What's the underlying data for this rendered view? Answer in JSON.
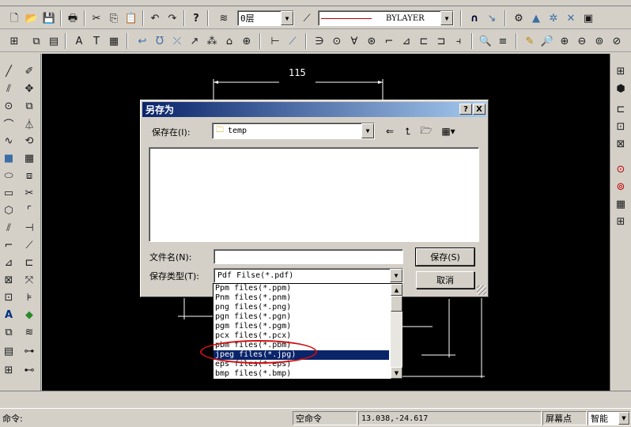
{
  "layer_combo": {
    "value": "0层"
  },
  "linetype_combo": {
    "value": "BYLAYER"
  },
  "drawing": {
    "dim_top": "115"
  },
  "dialog": {
    "title": "另存为",
    "help_btn": "?",
    "close_btn": "X",
    "save_in_label": "保存在(I):",
    "save_in_value": "temp",
    "filename_label": "文件名(N):",
    "filename_value": "",
    "filetype_label": "保存类型(T):",
    "filetype_value": "Pdf Filse(*.pdf)",
    "save_button": "保存(S)",
    "cancel_button": "取消"
  },
  "filetype_options": [
    "Ppm files(*.ppm)",
    "Pnm files(*.pnm)",
    "png files(*.png)",
    "pgn files(*.pgn)",
    "pgm files(*.pgm)",
    "pcx files(*.pcx)",
    "pbm files(*.pbm)",
    "jpeg files(*.jpg)",
    "eps files(*.eps)",
    "bmp files(*.bmp)"
  ],
  "filetype_selected_index": 7,
  "statusbar": {
    "command_prompt": "命令:",
    "command_state": "空命令",
    "coordinates": "13.038,-24.617",
    "screen_point": "屏幕点",
    "smart_mode": "智能"
  },
  "colors": {
    "title_bar": "#0a246a",
    "selection": "#0a246a",
    "canvas": "#000000",
    "annotation_circle": "#d01010"
  }
}
